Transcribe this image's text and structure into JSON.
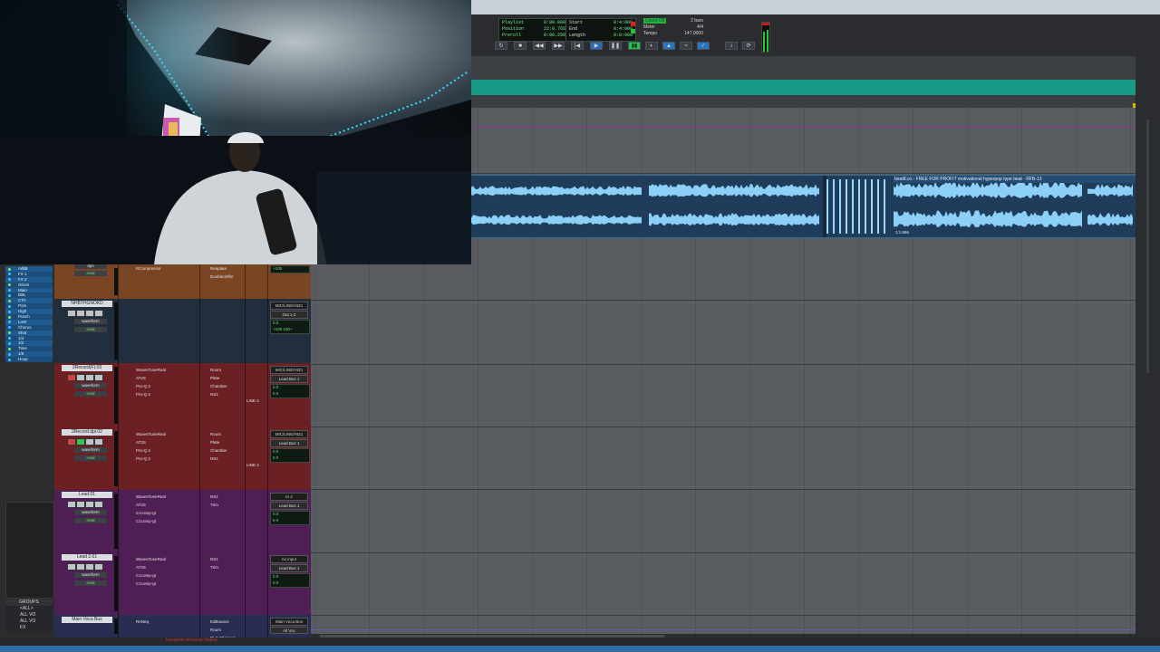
{
  "transport": {
    "counters": {
      "labels": [
        "Playlist",
        "Position",
        "Preroll"
      ],
      "values": [
        "0:00.000",
        "22:0.765",
        "0:00.250"
      ],
      "range_labels": [
        "Start",
        "End",
        "Length"
      ],
      "range_values": [
        "8:4:009",
        "8:4:009",
        "0:0:000"
      ]
    },
    "midi_status": "Count Off",
    "meter_labels": [
      "Meter",
      "Tempo"
    ],
    "bars": "2 bars",
    "meter_value": "4/4",
    "tempo_value": "147.0000"
  },
  "clips": {
    "second_clip_label": "beat8.co - FREE FOR PROFIT motivational hyperpop type beat - RFB-13",
    "second_clip_duration": "1:1.666"
  },
  "mixer": {
    "tracks": [
      {
        "name": "",
        "view": "dyn",
        "view2": "read",
        "color": "#7a4522",
        "inserts": [
          "RCompressor",
          "",
          "",
          ""
        ],
        "sends": [
          "Reaplate",
          "Doubledoffer"
        ],
        "io": "",
        "io2": "",
        "vol": "+100",
        "pan": "100+"
      },
      {
        "name": "NHBTHGNOKD",
        "view": "waveform",
        "view2": "read",
        "color": "#202e3d",
        "inserts": [
          "",
          "",
          "",
          ""
        ],
        "sends": [
          "",
          ""
        ],
        "io": "MIC/LINE/HIZ1",
        "io2": "Out 1-2",
        "vol": "0.0",
        "pan": "+100 100+"
      },
      {
        "name": "2Record(F).03",
        "view": "waveform",
        "view2": "read",
        "color": "#6b2023",
        "inserts": [
          "WavesTuneReal",
          "AT2S",
          "",
          "Pro-Q 3",
          "Pro-Q 3"
        ],
        "sends": [
          "Room",
          "Plate",
          "Chamber",
          "",
          "NS1"
        ],
        "io": "MIC/LINE/HIZ1",
        "io2": "Lead Bus 1",
        "vol": "0.0",
        "pan": "0 0",
        "extra": "LINE 4"
      },
      {
        "name": "2Record.dpl.02",
        "view": "waveform",
        "view2": "read",
        "color": "#6b2023",
        "inserts": [
          "WavesTuneReal",
          "AT2S",
          "",
          "Pro-Q 3",
          "Pro-Q 3"
        ],
        "sends": [
          "Room",
          "Plate",
          "Chamber",
          "",
          "NS1"
        ],
        "io": "MIC/LINE/HIZ1",
        "io2": "Lead Bus 1",
        "vol": "0.0",
        "pan": "0 0",
        "extra": "LINE 4"
      },
      {
        "name": "Lead.01",
        "view": "waveform",
        "view2": "read",
        "color": "#4f1e55",
        "inserts": [
          "WavesTuneReal",
          "AT2S",
          "C1comp-gt",
          "",
          "C1comp-gt"
        ],
        "sends": [
          "NS1",
          "Trim",
          "",
          "",
          ""
        ],
        "io": "In 2",
        "io2": "Lead Bus 1",
        "vol": "0.0",
        "pan": "0 0"
      },
      {
        "name": "Lead 2.01",
        "view": "waveform",
        "view2": "read",
        "color": "#4f1e55",
        "inserts": [
          "WavesTuneReal",
          "AT2S",
          "C1comp-gt",
          "",
          "C1comp-gt"
        ],
        "sends": [
          "NS1",
          "Trim",
          "",
          "",
          ""
        ],
        "io": "no input",
        "io2": "Lead Bus 1",
        "vol": "0.0",
        "pan": "0 0"
      },
      {
        "name": "Main Voca Bus",
        "view": "",
        "view2": "",
        "color": "#2a2d52",
        "inserts": [
          "ReNeq"
        ],
        "sends": [
          "EdBounce",
          "Room",
          "RLS Channel",
          "Plate"
        ],
        "io": "Main Voca Bus",
        "io2": "All Voc",
        "vol": "",
        "pan": ""
      }
    ]
  },
  "tracklist": {
    "items": [
      "AdliB",
      "FX 1",
      "FX 2",
      "Ghost",
      "Main",
      "DBL",
      "CTA",
      "Pom",
      "High",
      "Punch",
      "LoW",
      "Chorus",
      "Shot",
      "1/4",
      "1/2",
      "Time",
      "1/8",
      "Hoop"
    ]
  },
  "groups": {
    "title": "GROUPS",
    "items": [
      "<ALL>",
      "ALL VO",
      "ALL VO",
      "FX"
    ]
  },
  "status": {
    "bottom_text": "transport rehearse history"
  }
}
